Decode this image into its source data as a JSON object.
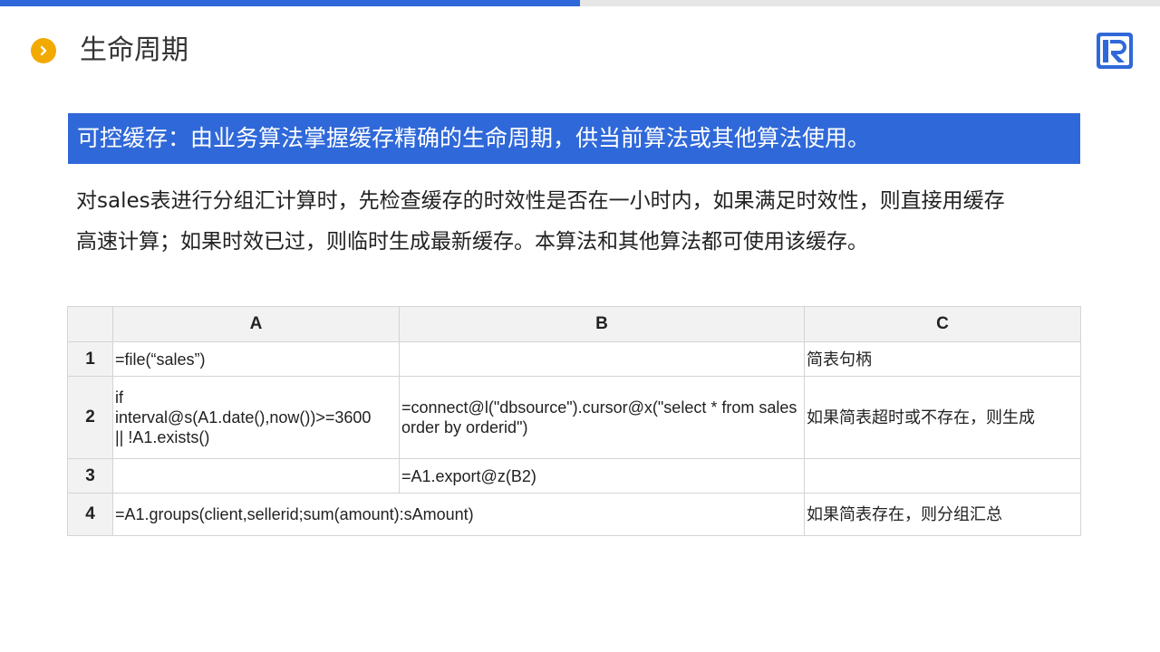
{
  "header": {
    "title": "生命周期",
    "progress_fraction": 0.5
  },
  "icons": {
    "title_bullet": "chevron-right-icon",
    "brand": "brand-logo-icon"
  },
  "colors": {
    "accent": "#2f68d9",
    "bullet": "#f2a900",
    "header_cell": "#f2f2f2"
  },
  "banner": {
    "text": "可控缓存：由业务算法掌握缓存精确的生命周期，供当前算法或其他算法使用。"
  },
  "description": {
    "line1": "对sales表进行分组汇计算时，先检查缓存的时效性是否在一小时内，如果满足时效性，则直接用缓存",
    "line2": "高速计算；如果时效已过，则临时生成最新缓存。本算法和其他算法都可使用该缓存。"
  },
  "grid": {
    "columns": [
      "A",
      "B",
      "C"
    ],
    "rows": [
      {
        "num": "1",
        "a": "=file(“sales”)",
        "b": "",
        "c": "简表句柄"
      },
      {
        "num": "2",
        "a": "if\ninterval@s(A1.date(),now())>=3600\n|| !A1.exists()",
        "b": "=connect@l(\"dbsource\").cursor@x(\"select * from sales order by orderid\")",
        "c": "如果简表超时或不存在，则生成"
      },
      {
        "num": "3",
        "a": "",
        "b": "=A1.export@z(B2)",
        "c": ""
      },
      {
        "num": "4",
        "ab": "=A1.groups(client,sellerid;sum(amount):sAmount)",
        "c": "如果简表存在，则分组汇总"
      }
    ]
  }
}
